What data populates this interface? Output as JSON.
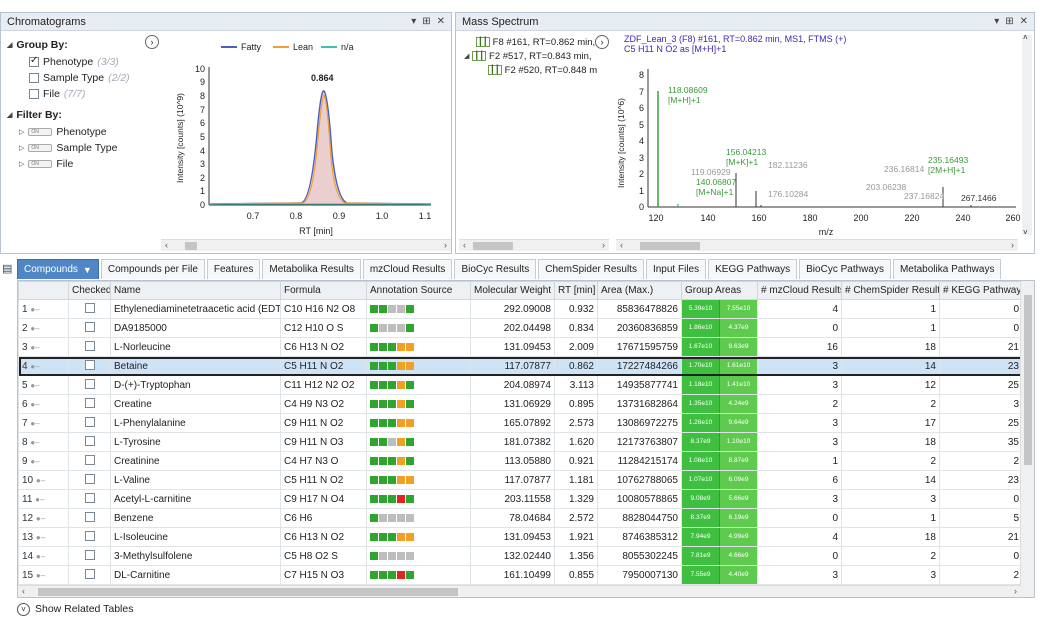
{
  "chrom": {
    "title": "Chromatograms",
    "group_by": "Group By:",
    "options": [
      {
        "label": "Phenotype",
        "count": "(3/3)",
        "checked": true
      },
      {
        "label": "Sample Type",
        "count": "(2/2)",
        "checked": false
      },
      {
        "label": "File",
        "count": "(7/7)",
        "checked": false
      }
    ],
    "filter_by": "Filter By:",
    "filters": [
      "Phenotype",
      "Sample Type",
      "File"
    ],
    "toggle_text": "ON",
    "legend": [
      "Fatty",
      "Lean",
      "n/a"
    ],
    "peak_label": "0.864",
    "ylabel": "Intensity [counts] (10^9)",
    "xlabel": "RT [min]"
  },
  "ms": {
    "title": "Mass Spectrum",
    "tree": [
      "F8 #161, RT=0.862 min,",
      "F2 #517, RT=0.843 min,",
      "F2 #520, RT=0.848 m"
    ],
    "header1": "ZDF_Lean_3 (F8) #161, RT=0.862 min, MS1, FTMS (+)",
    "header2": "C5 H11 N O2 as [M+H]+1",
    "ylabel": "Intensity [counts] (10^6)",
    "xlabel": "m/z"
  },
  "tabs": [
    "Compounds",
    "Compounds per File",
    "Features",
    "Metabolika Results",
    "mzCloud Results",
    "BioCyc Results",
    "ChemSpider Results",
    "Input Files",
    "KEGG Pathways",
    "BioCyc Pathways",
    "Metabolika Pathways"
  ],
  "table": {
    "headers": [
      "",
      "Checked",
      "Name",
      "Formula",
      "Annotation Source",
      "Molecular Weight",
      "RT [min]",
      "Area (Max.)",
      "Group Areas",
      "# mzCloud Results",
      "# ChemSpider Results",
      "# KEGG Pathways"
    ],
    "rows": [
      {
        "n": "1",
        "name": "Ethylenediaminetetraacetic acid (EDTA)",
        "formula": "C10 H16 N2 O8",
        "anno": "ggyyg",
        "mw": "292.09008",
        "rt": "0.932",
        "area": "85836478826",
        "ga1": "5.39e10",
        "ga2": "7.55e10",
        "mz": "4",
        "cs": "1",
        "kegg": "0"
      },
      {
        "n": "2",
        "name": "DA9185000",
        "formula": "C12 H10 O S",
        "anno": "gyyyg",
        "mw": "202.04498",
        "rt": "0.834",
        "area": "20360836859",
        "ga1": "1.86e10",
        "ga2": "4.37e9",
        "mz": "0",
        "cs": "1",
        "kegg": "0"
      },
      {
        "n": "3",
        "name": "L-Norleucine",
        "formula": "C6 H13 N O2",
        "anno": "gggoo",
        "mw": "131.09453",
        "rt": "2.009",
        "area": "17671595759",
        "ga1": "1.67e10",
        "ga2": "9.63e9",
        "mz": "16",
        "cs": "18",
        "kegg": "21"
      },
      {
        "n": "4",
        "name": "Betaine",
        "formula": "C5 H11 N O2",
        "anno": "gggoo",
        "mw": "117.07877",
        "rt": "0.862",
        "area": "17227484266",
        "ga1": "1.70e10",
        "ga2": "1.61e10",
        "mz": "3",
        "cs": "14",
        "kegg": "23",
        "sel": true
      },
      {
        "n": "5",
        "name": "D-(+)-Tryptophan",
        "formula": "C11 H12 N2 O2",
        "anno": "gggog",
        "mw": "204.08974",
        "rt": "3.113",
        "area": "14935877741",
        "ga1": "1.18e10",
        "ga2": "1.41e10",
        "mz": "3",
        "cs": "12",
        "kegg": "25"
      },
      {
        "n": "6",
        "name": "Creatine",
        "formula": "C4 H9 N3 O2",
        "anno": "gggog",
        "mw": "131.06929",
        "rt": "0.895",
        "area": "13731682864",
        "ga1": "1.35e10",
        "ga2": "4.24e9",
        "mz": "2",
        "cs": "2",
        "kegg": "3"
      },
      {
        "n": "7",
        "name": "L-Phenylalanine",
        "formula": "C9 H11 N O2",
        "anno": "gggoo",
        "mw": "165.07892",
        "rt": "2.573",
        "area": "13086972275",
        "ga1": "1.26e10",
        "ga2": "9.64e9",
        "mz": "3",
        "cs": "17",
        "kegg": "25"
      },
      {
        "n": "8",
        "name": "L-Tyrosine",
        "formula": "C9 H11 N O3",
        "anno": "ggyog",
        "mw": "181.07382",
        "rt": "1.620",
        "area": "12173763807",
        "ga1": "8.37e9",
        "ga2": "1.10e10",
        "mz": "3",
        "cs": "18",
        "kegg": "35"
      },
      {
        "n": "9",
        "name": "Creatinine",
        "formula": "C4 H7 N3 O",
        "anno": "gggog",
        "mw": "113.05880",
        "rt": "0.921",
        "area": "11284215174",
        "ga1": "1.08e10",
        "ga2": "8.87e9",
        "mz": "1",
        "cs": "2",
        "kegg": "2"
      },
      {
        "n": "10",
        "name": "L-Valine",
        "formula": "C5 H11 N O2",
        "anno": "gggoo",
        "mw": "117.07877",
        "rt": "1.181",
        "area": "10762788065",
        "ga1": "1.07e10",
        "ga2": "6.09e9",
        "mz": "6",
        "cs": "14",
        "kegg": "23"
      },
      {
        "n": "11",
        "name": "Acetyl-L-carnitine",
        "formula": "C9 H17 N O4",
        "anno": "gggrg",
        "mw": "203.11558",
        "rt": "1.329",
        "area": "10080578865",
        "ga1": "9.08e9",
        "ga2": "5.66e9",
        "mz": "3",
        "cs": "3",
        "kegg": "0"
      },
      {
        "n": "12",
        "name": "Benzene",
        "formula": "C6 H6",
        "anno": "gyyyy",
        "mw": "78.04684",
        "rt": "2.572",
        "area": "8828044750",
        "ga1": "8.37e9",
        "ga2": "6.19e9",
        "mz": "0",
        "cs": "1",
        "kegg": "5"
      },
      {
        "n": "13",
        "name": "L-Isoleucine",
        "formula": "C6 H13 N O2",
        "anno": "gggoo",
        "mw": "131.09453",
        "rt": "1.921",
        "area": "8746385312",
        "ga1": "7.94e9",
        "ga2": "4.99e9",
        "mz": "4",
        "cs": "18",
        "kegg": "21"
      },
      {
        "n": "14",
        "name": "3-Methylsulfolene",
        "formula": "C5 H8 O2 S",
        "anno": "gyyyy",
        "mw": "132.02440",
        "rt": "1.356",
        "area": "8055302245",
        "ga1": "7.81e9",
        "ga2": "4.66e9",
        "mz": "0",
        "cs": "2",
        "kegg": "0"
      },
      {
        "n": "15",
        "name": "DL-Carnitine",
        "formula": "C7 H15 N O3",
        "anno": "gggrg",
        "mw": "161.10499",
        "rt": "0.855",
        "area": "7950007130",
        "ga1": "7.55e9",
        "ga2": "4.40e9",
        "mz": "3",
        "cs": "3",
        "kegg": "2"
      }
    ]
  },
  "footer": "Show Related Tables",
  "colors": {
    "fatty": "#4a5fc1",
    "lean": "#f0a030",
    "na": "#40c0b0",
    "selected": "#cfe3f7",
    "tab_active": "#4f86c6"
  }
}
